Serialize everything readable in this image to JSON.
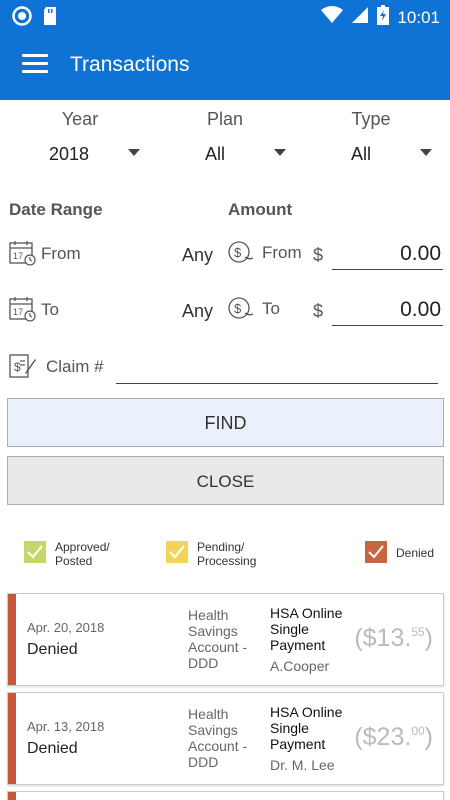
{
  "status_bar": {
    "time": "10:01"
  },
  "app_bar": {
    "title": "Transactions"
  },
  "filters": {
    "year": {
      "label": "Year",
      "value": "2018"
    },
    "plan": {
      "label": "Plan",
      "value": "All"
    },
    "type": {
      "label": "Type",
      "value": "All"
    }
  },
  "date_range": {
    "heading": "Date Range",
    "from_label": "From",
    "from_value": "Any",
    "to_label": "To",
    "to_value": "Any"
  },
  "amount": {
    "heading": "Amount",
    "from_label": "From",
    "from_currency": "$",
    "from_value": "0.00",
    "to_label": "To",
    "to_currency": "$",
    "to_value": "0.00"
  },
  "claim": {
    "label": "Claim #",
    "value": ""
  },
  "buttons": {
    "find": "FIND",
    "close": "CLOSE"
  },
  "legend": [
    {
      "line1": "Approved/",
      "line2": "Posted",
      "color": "#c3d86a"
    },
    {
      "line1": "Pending/",
      "line2": "Processing",
      "color": "#f3d35a"
    },
    {
      "line1": "Denied",
      "line2": "",
      "color": "#c56640"
    }
  ],
  "transactions": [
    {
      "date": "Apr. 20, 2018",
      "status": "Denied",
      "account_1": "Health",
      "account_2": "Savings",
      "account_3": "Account -",
      "account_4": "DDD",
      "desc_1": "HSA Online",
      "desc_2": "Single",
      "desc_3": "Payment",
      "payer": "A.Cooper",
      "amount_main": "($13.",
      "amount_cents": "55",
      "amount_close": ")",
      "stripe_color": "#c5593a"
    },
    {
      "date": "Apr. 13, 2018",
      "status": "Denied",
      "account_1": "Health",
      "account_2": "Savings",
      "account_3": "Account -",
      "account_4": "DDD",
      "desc_1": "HSA Online",
      "desc_2": "Single",
      "desc_3": "Payment",
      "payer": "Dr. M. Lee",
      "amount_main": "($23.",
      "amount_cents": "00",
      "amount_close": ")",
      "stripe_color": "#c5593a"
    }
  ]
}
